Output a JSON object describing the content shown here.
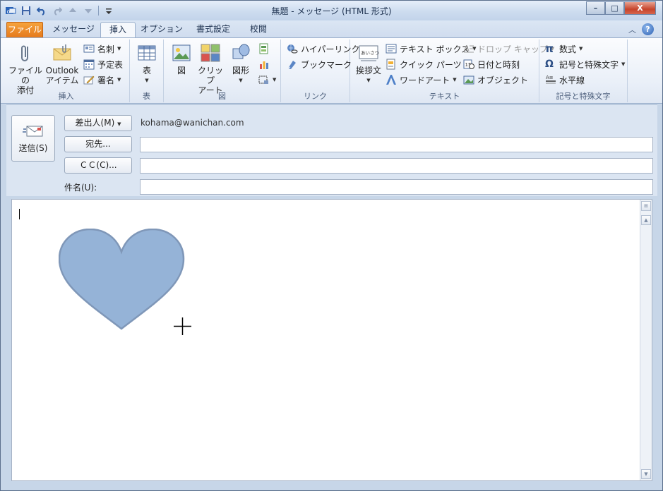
{
  "window": {
    "title": "無題 - メッセージ (HTML 形式)",
    "controls": {
      "minimize": "–",
      "maximize": "□",
      "close": "X"
    }
  },
  "quick_access": {
    "icons": [
      "outlook-icon",
      "save-icon",
      "undo-icon",
      "redo-icon",
      "up-arrow-icon",
      "down-arrow-icon",
      "customize-icon"
    ]
  },
  "tabs": [
    {
      "label": "ファイル"
    },
    {
      "label": "メッセージ"
    },
    {
      "label": "挿入",
      "active": true
    },
    {
      "label": "オプション"
    },
    {
      "label": "書式設定"
    },
    {
      "label": "校閲"
    }
  ],
  "help_icon": "?",
  "ribbon": {
    "group_insert": {
      "label": "挿入",
      "attach_file": "ファイルの\n添付",
      "attach_file_l1": "ファイルの",
      "attach_file_l2": "添付",
      "outlook_item_l1": "Outlook",
      "outlook_item_l2": "アイテム",
      "business_card": "名刺",
      "calendar": "予定表",
      "signature": "署名"
    },
    "group_table": {
      "label": "表",
      "table": "表"
    },
    "group_illustrations": {
      "label": "図",
      "picture": "図",
      "clipart_l1": "クリップ",
      "clipart_l2": "アート",
      "shapes": "図形"
    },
    "group_links": {
      "label": "リンク",
      "hyperlink": "ハイパーリンク",
      "bookmark": "ブックマーク"
    },
    "group_text": {
      "label": "テキスト",
      "greeting": "挨拶文",
      "textbox": "テキスト ボックス",
      "quickparts": "クイック パーツ",
      "wordart": "ワードアート",
      "dropcap": "ドロップ キャップ",
      "datetime": "日付と時刻",
      "object": "オブジェクト"
    },
    "group_symbols": {
      "label": "記号と特殊文字",
      "equation": "数式",
      "symbol": "記号と特殊文字",
      "hline": "水平線"
    }
  },
  "header": {
    "send": "送信(S)",
    "from_button": "差出人(M)",
    "from_value": "kohama@wanichan.com",
    "to_button": "宛先...",
    "cc_button": "ＣＣ(C)...",
    "subject_label": "件名(U):",
    "to_value": "",
    "cc_value": "",
    "subject_value": ""
  },
  "body": {
    "heart_fill": "#95b3d7",
    "heart_stroke": "#7f97b8"
  }
}
